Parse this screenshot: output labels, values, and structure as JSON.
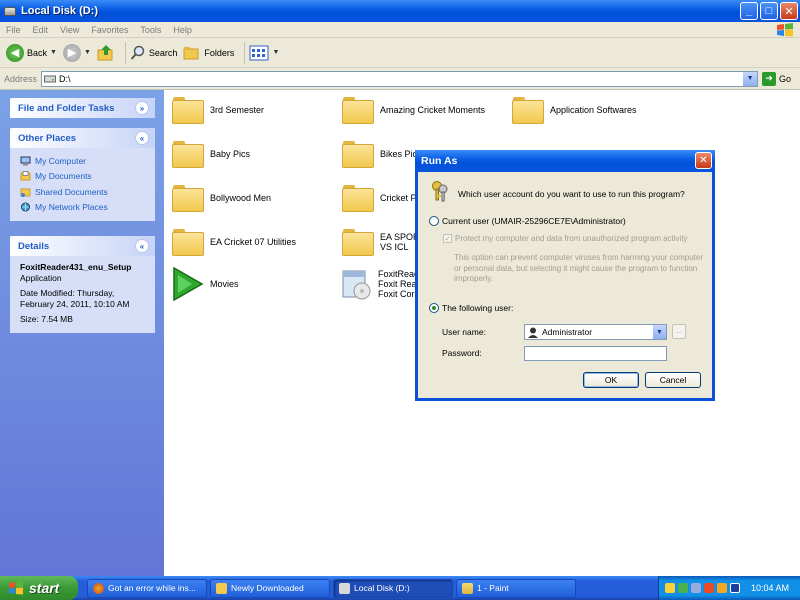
{
  "window": {
    "title": "Local Disk (D:)"
  },
  "menu": [
    "File",
    "Edit",
    "View",
    "Favorites",
    "Tools",
    "Help"
  ],
  "toolbar": {
    "back_label": "Back",
    "search_label": "Search",
    "folders_label": "Folders"
  },
  "address": {
    "label": "Address",
    "value": "D:\\",
    "go_label": "Go"
  },
  "left_panel": {
    "file_tasks_title": "File and Folder Tasks",
    "other_places_title": "Other Places",
    "other_places": [
      "My Computer",
      "My Documents",
      "Shared Documents",
      "My Network Places"
    ],
    "details_title": "Details",
    "details": {
      "name": "FoxitReader431_enu_Setup",
      "type": "Application",
      "modified": "Date Modified: Thursday, February 24, 2011, 10:10 AM",
      "size": "Size: 7.54 MB"
    }
  },
  "files": {
    "row1": [
      "3rd Semester",
      "Amazing Cricket Moments",
      "Application Softwares"
    ],
    "row2": [
      "Baby Pics",
      "Bikes PicS"
    ],
    "row3": [
      "Bollywood Men",
      "Cricket Ph"
    ],
    "row4_a": "EA Cricket 07 Utilities",
    "row4_b_line1": "EA SPORT",
    "row4_b_line2": "VS ICL",
    "movies": "Movies",
    "foxit_line1": "FoxitRead",
    "foxit_line2": "Foxit Rea",
    "foxit_line3": "Foxit Corp"
  },
  "dialog": {
    "title": "Run As",
    "question": "Which user account do you want to use to run this program?",
    "current_user": "Current user (UMAIR-25296CE7E\\Administrator)",
    "protect_label": "Protect my computer and data from unauthorized program activity",
    "help_text": "This option can prevent computer viruses from harming your computer or personal data, but selecting it might cause the program to function improperly.",
    "following_user": "The following user:",
    "username_label": "User name:",
    "username_value": "Administrator",
    "password_label": "Password:",
    "browse_label": "...",
    "ok_label": "OK",
    "cancel_label": "Cancel"
  },
  "taskbar": {
    "start_label": "start",
    "tasks": [
      "Got an error while ins...",
      "Newly Downloaded",
      "Local Disk (D:)",
      "1 - Paint"
    ],
    "clock": "10:04 AM"
  }
}
